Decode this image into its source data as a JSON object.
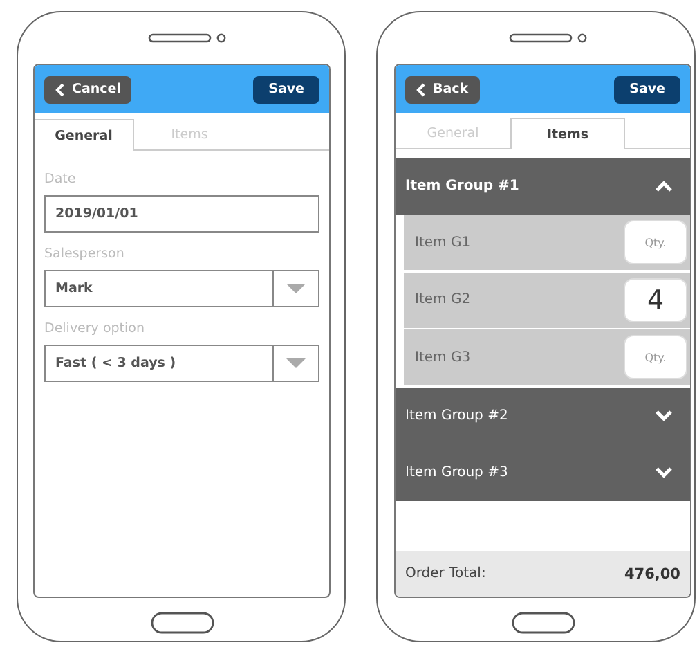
{
  "phones": [
    {
      "kind": "form",
      "header": {
        "back_button": "Cancel",
        "save_button": "Save"
      },
      "tabs": [
        {
          "label": "General",
          "selected": true
        },
        {
          "label": "Items",
          "selected": false
        }
      ],
      "fields": [
        {
          "kind": "text",
          "label": "Date",
          "value": "2019/01/01"
        },
        {
          "kind": "select",
          "label": "Salesperson",
          "value": "Mark"
        },
        {
          "kind": "select",
          "label": "Delivery option",
          "value": "Fast ( < 3 days )"
        }
      ]
    },
    {
      "kind": "items",
      "header": {
        "back_button": "Back",
        "save_button": "Save"
      },
      "tabs": [
        {
          "label": "General",
          "selected": false
        },
        {
          "label": "Items",
          "selected": true
        }
      ],
      "groups": [
        {
          "title": "Item Group #1",
          "expanded": true,
          "items": [
            {
              "name": "Item G1",
              "quantity": {
                "placeholder": "Qty."
              }
            },
            {
              "name": "Item G2",
              "quantity": {
                "value": "4"
              }
            },
            {
              "name": "Item G3",
              "quantity": {
                "placeholder": "Qty."
              }
            }
          ]
        },
        {
          "title": "Item Group #2",
          "expanded": false
        },
        {
          "title": "Item Group #3",
          "expanded": false
        }
      ],
      "footer": {
        "label": "Order Total:",
        "value": "476,00"
      }
    }
  ]
}
